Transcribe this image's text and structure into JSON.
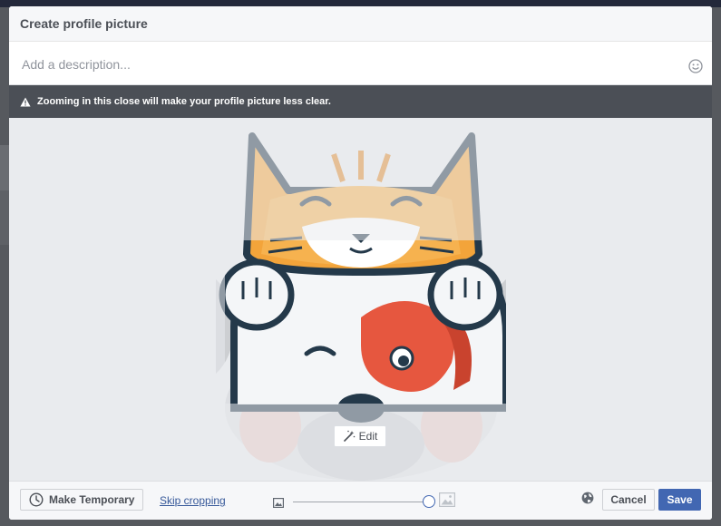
{
  "dialog": {
    "title": "Create profile picture"
  },
  "description": {
    "placeholder": "Add a description...",
    "emoji_icon": "smiley-icon"
  },
  "warning": {
    "icon": "warning-icon",
    "text": "Zooming in this close will make your profile picture less clear."
  },
  "photo": {
    "subject": "cat and dog mascot illustration",
    "edit_label": "Edit",
    "edit_icon": "magic-wand-icon"
  },
  "footer": {
    "make_temporary_label": "Make Temporary",
    "make_temporary_icon": "clock-icon",
    "skip_cropping_label": "Skip cropping",
    "zoom": {
      "small_icon": "image-small-icon",
      "large_icon": "image-large-icon",
      "level": 1.0
    },
    "privacy_icon": "globe-icon",
    "cancel_label": "Cancel",
    "save_label": "Save"
  },
  "colors": {
    "accent": "#4267b2",
    "warning_bg": "#4b4f56",
    "link": "#365899"
  }
}
